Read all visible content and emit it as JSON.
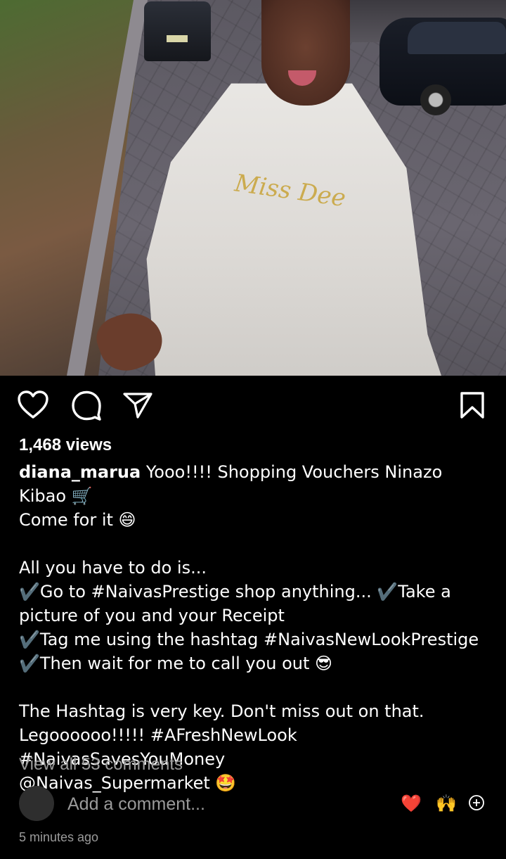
{
  "post": {
    "views_text": "1,468 views",
    "username": "diana_marua",
    "caption_body": " Yooo!!!! Shopping Vouchers Ninazo Kibao 🛒\nCome for it 😄\n\nAll you have to do is...\n✔️Go to #NaivasPrestige shop anything... ✔️Take a picture of you and your Receipt\n✔️Tag me using the hashtag #NaivasNewLookPrestige\n✔️Then wait for me to call you out 😎\n\nThe Hashtag is very key. Don't miss out on that.\nLegoooooo!!!!! #AFreshNewLook #NaivasSavesYouMoney\n@Naivas_Supermarket 🤩",
    "view_all_comments": "View all 53 comments",
    "add_comment_placeholder": "Add a comment...",
    "quick_emoji_heart": "❤️",
    "quick_emoji_hands": "🙌",
    "timestamp": "5 minutes ago",
    "shirt_logo_text": "Miss Dee"
  },
  "icons": {
    "like": "heart-outline-icon",
    "comment": "comment-bubble-icon",
    "share": "paper-plane-icon",
    "save": "bookmark-outline-icon",
    "add_emoji": "plus-circle-icon"
  },
  "colors": {
    "background": "#000000",
    "text_primary": "#ffffff",
    "text_secondary": "#9a9a9a",
    "heart_red": "#e0242c"
  }
}
